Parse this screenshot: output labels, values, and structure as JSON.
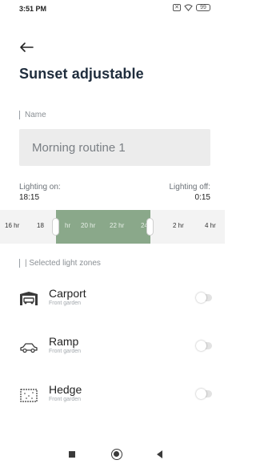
{
  "status_bar": {
    "time": "3:51 PM",
    "battery": "99",
    "icons": [
      "sim-icon",
      "wifi-icon",
      "battery-icon"
    ]
  },
  "header": {
    "back_icon": "back-arrow-icon",
    "title": "Sunset adjustable"
  },
  "name_field": {
    "label": "Name",
    "value": "Morning routine 1"
  },
  "lighting": {
    "on_label": "Lighting on:",
    "on_value": "18:15",
    "off_label": "Lighting off:",
    "off_value": "0:15"
  },
  "timeline": {
    "ticks": [
      "16 hr",
      "18 hr",
      "20 hr",
      "22 hr",
      "24 hr",
      "2 hr",
      "4 hr"
    ],
    "visible_ticks": [
      "16 hr",
      "18",
      "hr",
      "20 hr",
      "22 hr",
      "24",
      "2 hr",
      "4 hr"
    ],
    "range_color": "#8aa88a"
  },
  "zones": {
    "label": "| Selected light zones",
    "items": [
      {
        "name": "Carport",
        "subtitle": "Front garden",
        "icon": "carport-icon",
        "enabled": false
      },
      {
        "name": "Ramp",
        "subtitle": "Front garden",
        "icon": "car-icon",
        "enabled": false
      },
      {
        "name": "Hedge",
        "subtitle": "Front garden",
        "icon": "hedge-icon",
        "enabled": false
      }
    ]
  },
  "nav_bar": {
    "buttons": [
      "recents-button",
      "home-button",
      "back-button"
    ]
  }
}
